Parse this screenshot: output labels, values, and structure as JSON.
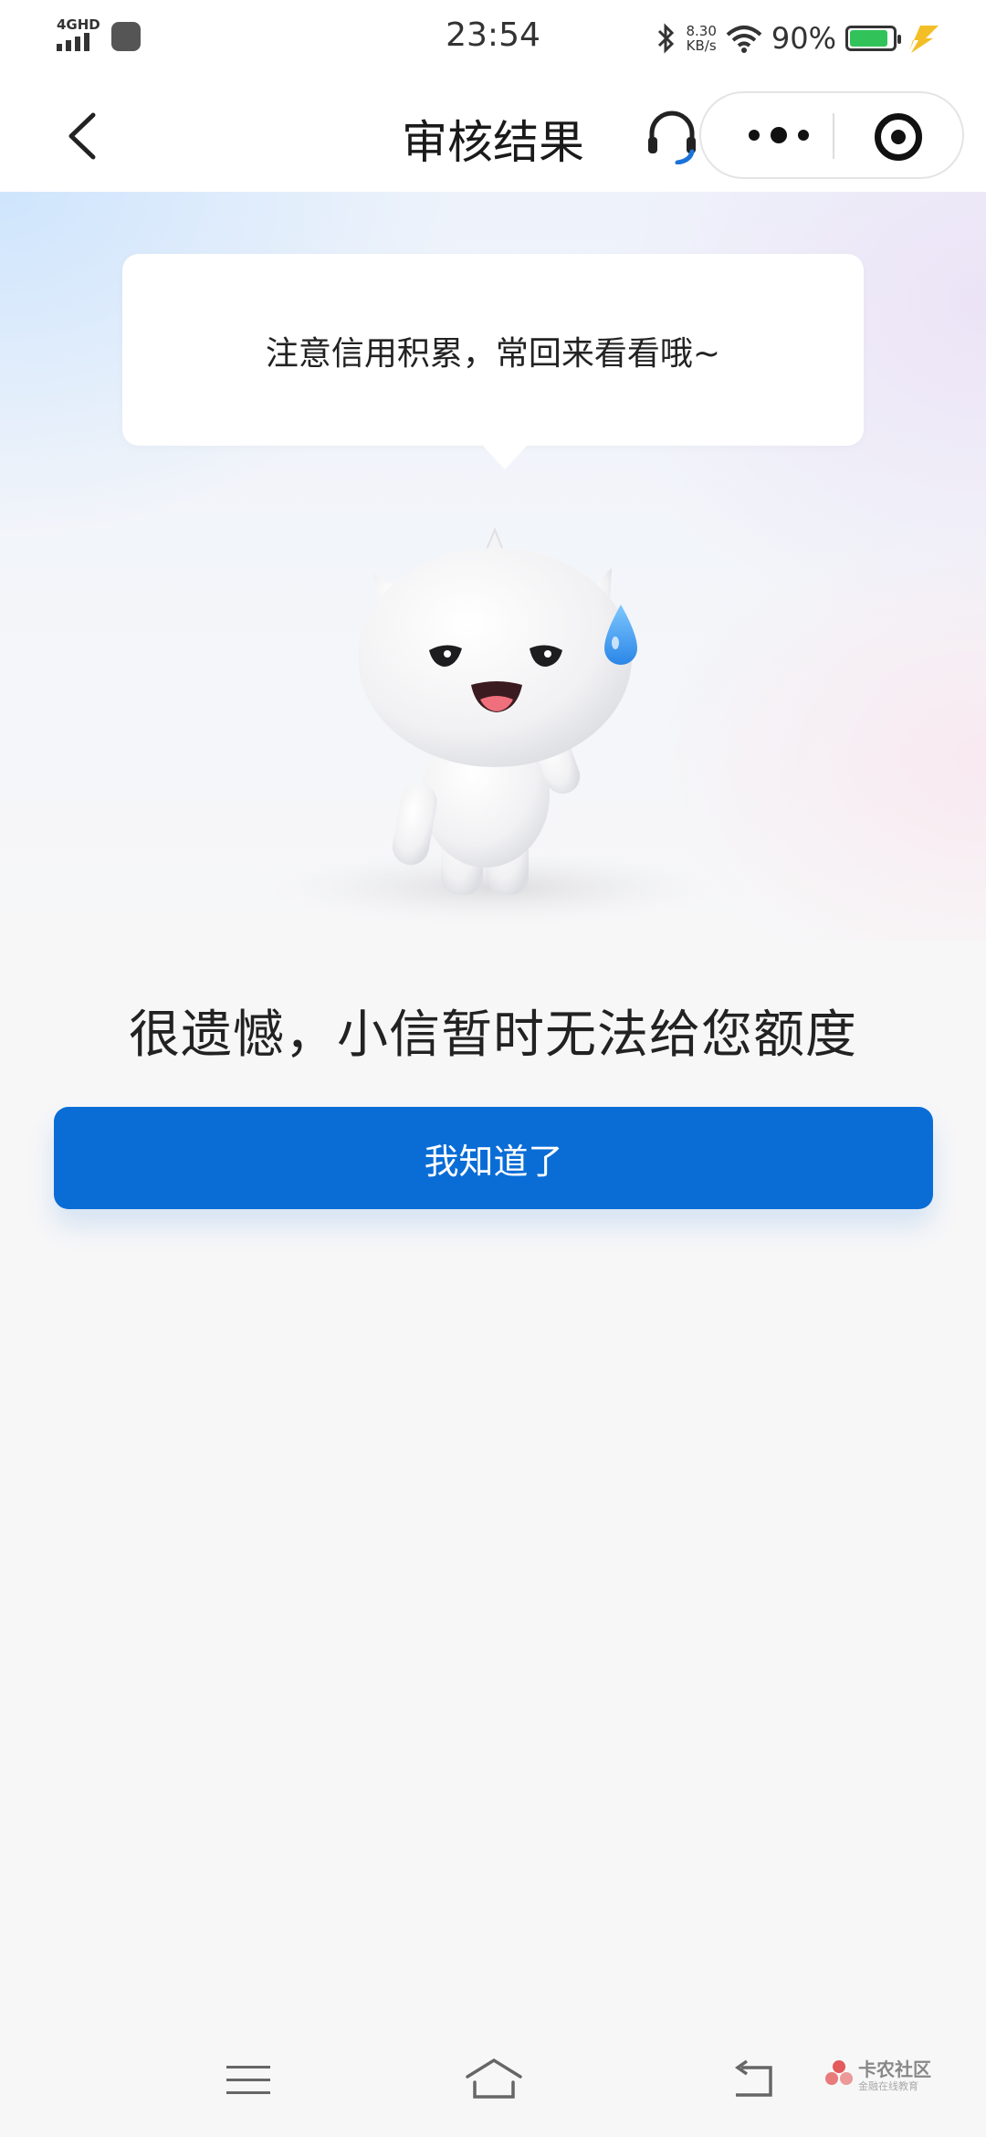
{
  "status_bar": {
    "network": "4GHD",
    "time": "23:54",
    "speed_value": "8.30",
    "speed_unit": "KB/s",
    "battery_percent": "90%",
    "battery_level": 0.9
  },
  "nav": {
    "title": "审核结果",
    "icons": [
      "back-chevron-icon",
      "headset-icon",
      "more-dots-icon",
      "target-circle-icon"
    ]
  },
  "bubble": {
    "text": "注意信用积累，常回来看看哦~"
  },
  "result": {
    "message": "很遗憾，小信暂时无法给您额度",
    "button_label": "我知道了"
  },
  "bottom_nav": {
    "icons": [
      "menu-icon",
      "home-icon",
      "back-icon"
    ]
  },
  "watermark": {
    "title": "卡农社区",
    "subtitle": "金融在线教育"
  },
  "colors": {
    "primary_button": "#0a6dd6",
    "battery_fill": "#31c35a",
    "charge_bolt": "#f2b300",
    "text_dark": "#222222"
  }
}
